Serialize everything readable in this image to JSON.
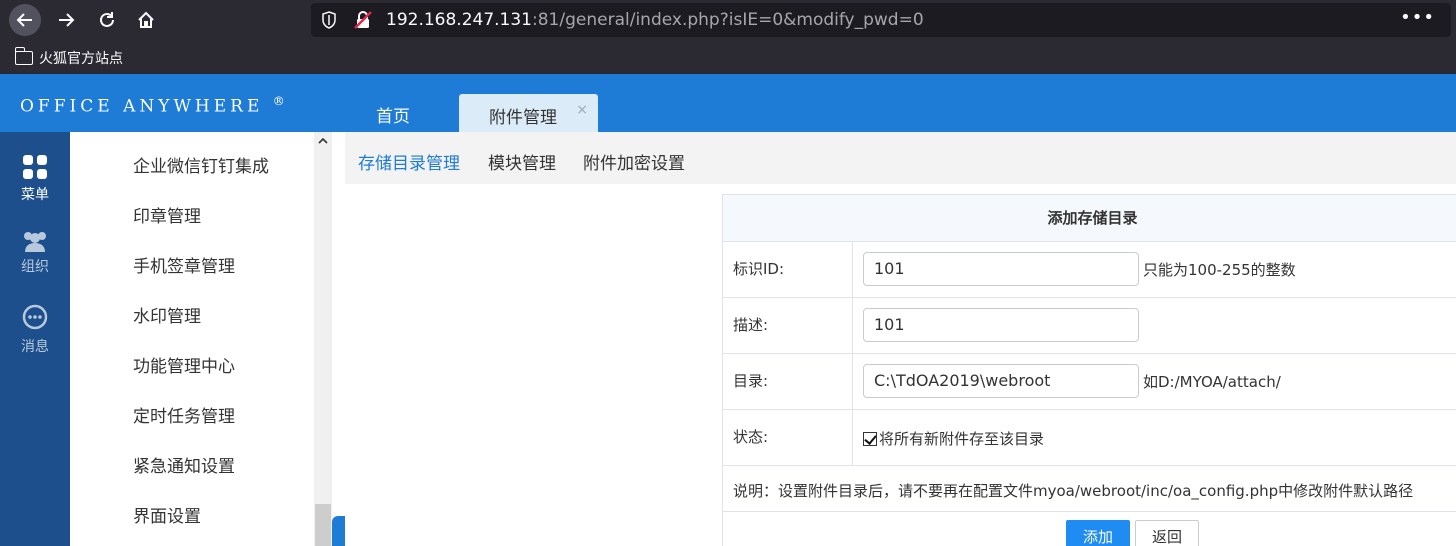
{
  "browser": {
    "url_host": "192.168.247.131",
    "url_rest": ":81/general/index.php?isIE=0&modify_pwd=0",
    "bookmark_label": "火狐官方站点",
    "more_label": "•••"
  },
  "app": {
    "logo_text": "OFFICE ANYWHERE",
    "logo_mark": "®",
    "tabs": [
      {
        "label": "首页"
      },
      {
        "label": "附件管理",
        "close": "×"
      }
    ]
  },
  "rail": {
    "items": [
      {
        "label": "菜单",
        "icon": "grid-icon"
      },
      {
        "label": "组织",
        "icon": "people-icon"
      },
      {
        "label": "消息",
        "icon": "chat-icon"
      }
    ]
  },
  "menu": {
    "items": [
      {
        "label": "企业微信钉钉集成"
      },
      {
        "label": "印章管理"
      },
      {
        "label": "手机签章管理"
      },
      {
        "label": "水印管理"
      },
      {
        "label": "功能管理中心"
      },
      {
        "label": "定时任务管理"
      },
      {
        "label": "紧急通知设置"
      },
      {
        "label": "界面设置"
      }
    ]
  },
  "subnav": {
    "items": [
      {
        "label": "存储目录管理"
      },
      {
        "label": "模块管理"
      },
      {
        "label": "附件加密设置"
      }
    ]
  },
  "form": {
    "title": "添加存储目录",
    "id_label": "标识ID:",
    "id_value": "101",
    "id_hint": "只能为100-255的整数",
    "desc_label": "描述:",
    "desc_value": "101",
    "dir_label": "目录:",
    "dir_value": "C:\\TdOA2019\\webroot",
    "dir_hint": "如D:/MYOA/attach/",
    "status_label": "状态:",
    "status_checkbox_label": "将所有新附件存至该目录",
    "note": "说明：设置附件目录后，请不要再在配置文件myoa/webroot/inc/oa_config.php中修改附件默认路径",
    "add_button": "添加",
    "back_button": "返回"
  }
}
